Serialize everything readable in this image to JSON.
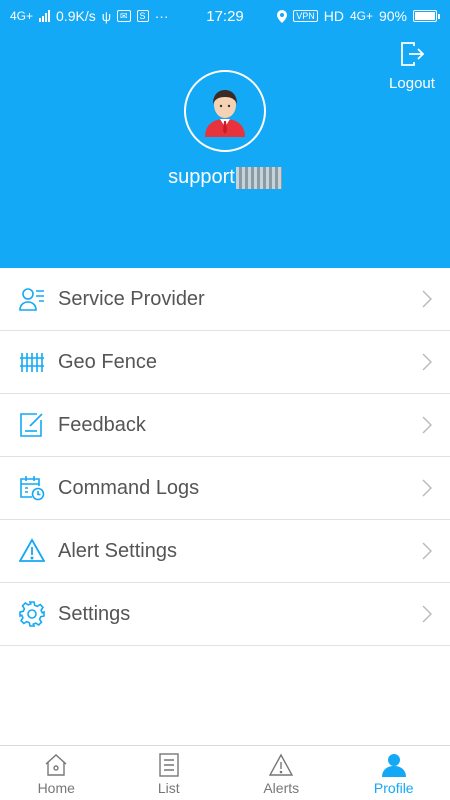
{
  "status_bar": {
    "network": "4G+",
    "speed": "0.9K/s",
    "time": "17:29",
    "vpn": "VPN",
    "hd": "HD",
    "network_right": "4G+",
    "battery": "90%"
  },
  "header": {
    "logout_label": "Logout",
    "username": "support",
    "background_color": "#13a9f6"
  },
  "menu": {
    "items": [
      {
        "label": "Service Provider",
        "icon": "service-provider-icon"
      },
      {
        "label": "Geo Fence",
        "icon": "geo-fence-icon"
      },
      {
        "label": "Feedback",
        "icon": "feedback-icon"
      },
      {
        "label": "Command Logs",
        "icon": "command-logs-icon"
      },
      {
        "label": "Alert Settings",
        "icon": "alert-settings-icon"
      },
      {
        "label": "Settings",
        "icon": "settings-icon"
      }
    ]
  },
  "tabbar": {
    "tabs": [
      {
        "label": "Home",
        "icon": "home-icon",
        "active": false
      },
      {
        "label": "List",
        "icon": "list-icon",
        "active": false
      },
      {
        "label": "Alerts",
        "icon": "alert-icon",
        "active": false
      },
      {
        "label": "Profile",
        "icon": "profile-icon",
        "active": true
      }
    ],
    "active_color": "#13a9f6"
  }
}
